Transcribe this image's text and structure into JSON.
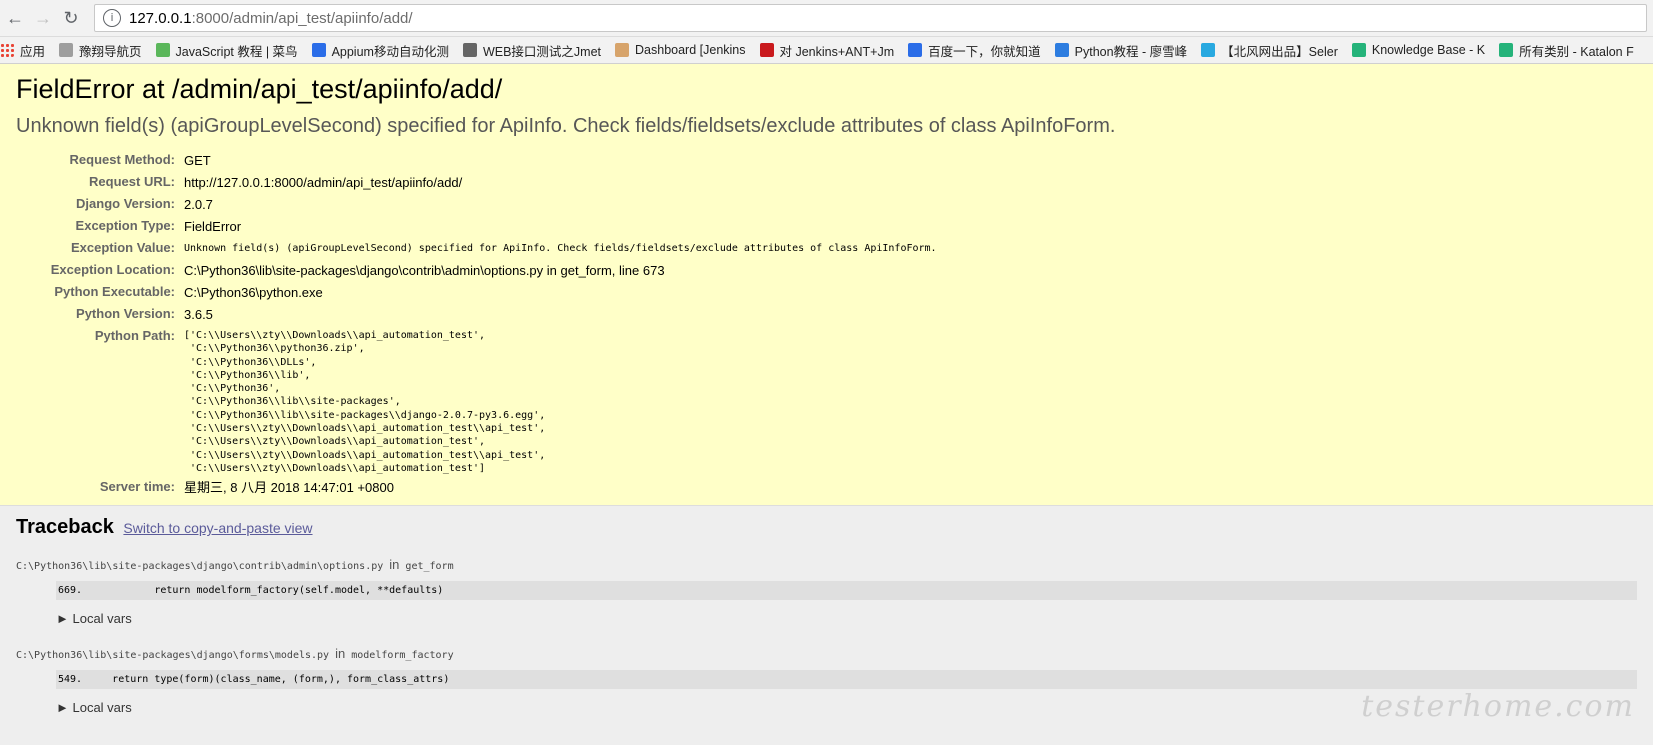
{
  "browser": {
    "url_host": "127.0.0.1",
    "url_rest": ":8000/admin/api_test/apiinfo/add/",
    "bookmarks": [
      {
        "label": "应用",
        "icon": "apps-grid-icon",
        "color": "#e94335"
      },
      {
        "label": "豫翔导航页",
        "icon": "page-icon",
        "color": "#9e9e9e"
      },
      {
        "label": "JavaScript 教程 | 菜鸟",
        "icon": "runoob-icon",
        "color": "#5bb75b"
      },
      {
        "label": "Appium移动自动化测",
        "icon": "baidu-paw-icon",
        "color": "#2b6de8"
      },
      {
        "label": "WEB接口测试之Jmet",
        "icon": "cnblogs-icon",
        "color": "#666666"
      },
      {
        "label": "Dashboard [Jenkins",
        "icon": "jenkins-icon",
        "color": "#d7a46b"
      },
      {
        "label": "对 Jenkins+ANT+Jm",
        "icon": "csdn-icon",
        "color": "#c9191d"
      },
      {
        "label": "百度一下，你就知道",
        "icon": "baidu-paw-icon",
        "color": "#2b6de8"
      },
      {
        "label": "Python教程 - 廖雪峰",
        "icon": "rocket-icon",
        "color": "#2d7de0"
      },
      {
        "label": "【北风网出品】Seler",
        "icon": "diamond-icon",
        "color": "#29a9e0"
      },
      {
        "label": "Knowledge Base - K",
        "icon": "katalon-icon",
        "color": "#25b37a"
      },
      {
        "label": "所有类别 - Katalon F",
        "icon": "katalon-icon",
        "color": "#25b37a"
      }
    ]
  },
  "summary": {
    "title": "FieldError at /admin/api_test/apiinfo/add/",
    "subtitle": "Unknown field(s) (apiGroupLevelSecond) specified for ApiInfo. Check fields/fieldsets/exclude attributes of class ApiInfoForm.",
    "rows": [
      {
        "label": "Request Method:",
        "value": "GET"
      },
      {
        "label": "Request URL:",
        "value": "http://127.0.0.1:8000/admin/api_test/apiinfo/add/"
      },
      {
        "label": "Django Version:",
        "value": "2.0.7"
      },
      {
        "label": "Exception Type:",
        "value": "FieldError"
      },
      {
        "label": "Exception Value:",
        "value": "Unknown field(s) (apiGroupLevelSecond) specified for ApiInfo. Check fields/fieldsets/exclude attributes of class ApiInfoForm."
      },
      {
        "label": "Exception Location:",
        "value": "C:\\Python36\\lib\\site-packages\\django\\contrib\\admin\\options.py in get_form, line 673"
      },
      {
        "label": "Python Executable:",
        "value": "C:\\Python36\\python.exe"
      },
      {
        "label": "Python Version:",
        "value": "3.6.5"
      },
      {
        "label": "Python Path:",
        "value": ""
      },
      {
        "label": "Server time:",
        "value": "星期三, 8 八月 2018 14:47:01 +0800"
      }
    ],
    "python_path": [
      "['C:\\\\Users\\\\zty\\\\Downloads\\\\api_automation_test',",
      " 'C:\\\\Python36\\\\python36.zip',",
      " 'C:\\\\Python36\\\\DLLs',",
      " 'C:\\\\Python36\\\\lib',",
      " 'C:\\\\Python36',",
      " 'C:\\\\Python36\\\\lib\\\\site-packages',",
      " 'C:\\\\Python36\\\\lib\\\\site-packages\\\\django-2.0.7-py3.6.egg',",
      " 'C:\\\\Users\\\\zty\\\\Downloads\\\\api_automation_test\\\\api_test',",
      " 'C:\\\\Users\\\\zty\\\\Downloads\\\\api_automation_test',",
      " 'C:\\\\Users\\\\zty\\\\Downloads\\\\api_automation_test\\\\api_test',",
      " 'C:\\\\Users\\\\zty\\\\Downloads\\\\api_automation_test']"
    ]
  },
  "traceback": {
    "heading": "Traceback",
    "switch_link": "Switch to copy-and-paste view",
    "frames": [
      {
        "file": "C:\\Python36\\lib\\site-packages\\django\\contrib\\admin\\options.py",
        "in": "in",
        "func": "get_form",
        "line": "669.            return modelform_factory(self.model, **defaults)",
        "locals": "► Local vars"
      },
      {
        "file": "C:\\Python36\\lib\\site-packages\\django\\forms\\models.py",
        "in": "in",
        "func": "modelform_factory",
        "line": "549.     return type(form)(class_name, (form,), form_class_attrs)",
        "locals": "► Local vars"
      }
    ]
  },
  "watermark": "testerhome.com"
}
